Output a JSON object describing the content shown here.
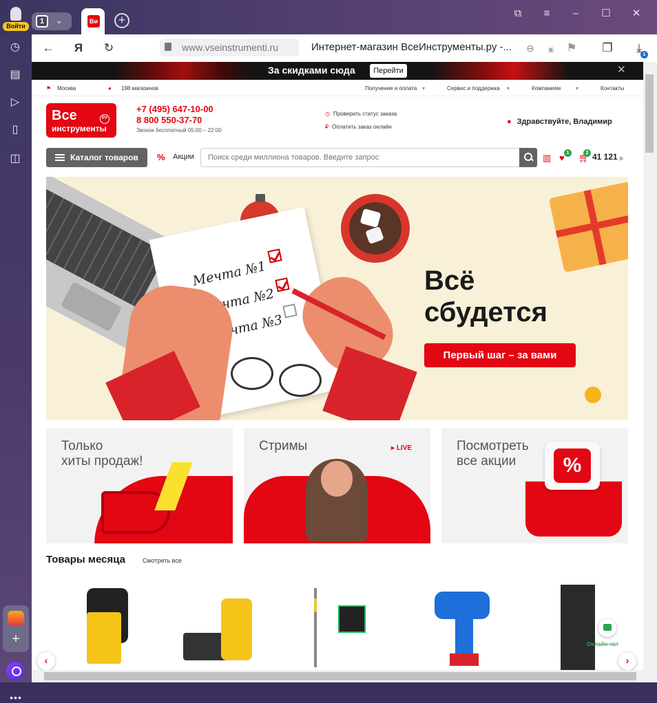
{
  "browser": {
    "login_label": "Войти",
    "tab_count": "1",
    "tab_favicon": "Ви",
    "url": "www.vseinstrumenti.ru",
    "page_title": "Интернет-магазин ВсеИнструменты.ру -...",
    "tab_shield_count": "6",
    "download_count": "1",
    "sidebar_icons": [
      "history-icon",
      "bookmarks-icon",
      "play-icon",
      "tab-icon",
      "screenshot-icon"
    ]
  },
  "promo_bar": {
    "text": "За скидками сюда",
    "button": "Перейти"
  },
  "top_links": {
    "city": "Москва",
    "stores": "198 магазинов",
    "delivery": "Получение и оплата",
    "service": "Сервис и поддержка",
    "companies": "Компаниям",
    "contacts": "Контакты"
  },
  "header": {
    "logo_line1": "Все",
    "logo_line2": "инструменты",
    "logo_ru": "РУ",
    "phone1": "+7 (495) 647-10-00",
    "phone2": "8 800 550-37-70",
    "call_free": "Звонок бесплатный 05:00 – 22:00",
    "check_order": "Проверить статус заказа",
    "pay_online": "Оплатить заказ онлайн",
    "greeting": "Здравствуйте, Владимир"
  },
  "search_row": {
    "catalog": "Каталог товаров",
    "promo": "Акции",
    "placeholder": "Поиск среди миллиона товаров. Введите запрос",
    "favorites_count": "1",
    "cart_count": "2",
    "cart_total": "41 121",
    "currency": "р."
  },
  "hero": {
    "dream1": "Мечта №1",
    "dream2": "Мечта №2",
    "dream3": "Мечта №3",
    "title": "Всё\nсбудется",
    "button": "Первый шаг – за вами"
  },
  "tiles": {
    "hits": "Только\nхиты продаж!",
    "streams": "Стримы",
    "live": "LIVE",
    "promos": "Посмотреть\nвсе акции",
    "percent": "%"
  },
  "products": {
    "title": "Товары месяца",
    "see_all": "Смотреть все",
    "chat_label": "Онлайн-чат"
  }
}
